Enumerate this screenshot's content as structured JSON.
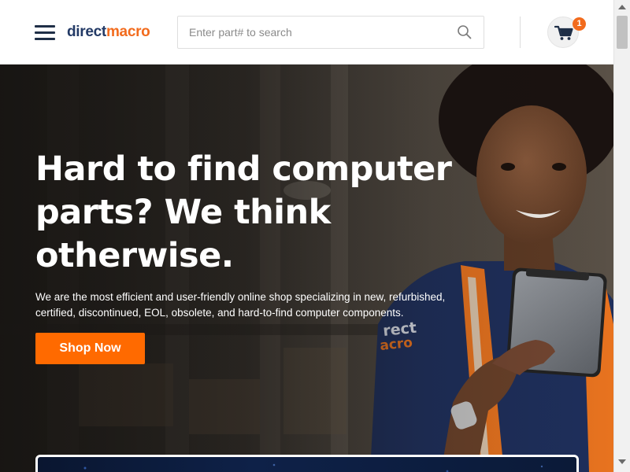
{
  "header": {
    "logo_part1": "direct",
    "logo_part2": "macro",
    "menu_icon": "hamburger-menu-icon",
    "search": {
      "placeholder": "Enter part# to search",
      "value": "",
      "icon": "search-icon"
    },
    "cart": {
      "icon": "shopping-cart-icon",
      "count": "1"
    }
  },
  "hero": {
    "title": "Hard to find computer parts? We think otherwise.",
    "description": "We are the most efficient and user-friendly online shop specializing in new, refurbished, certified, discontinued, EOL, obsolete, and hard-to-find computer components.",
    "cta_label": "Shop Now",
    "image_description_icon": "warehouse-worker-with-tablet-photo"
  },
  "colors": {
    "brand_navy": "#233a66",
    "brand_orange": "#f26b1d",
    "cta_orange": "#ff6a00",
    "hero_dark": "#2e2b28"
  }
}
